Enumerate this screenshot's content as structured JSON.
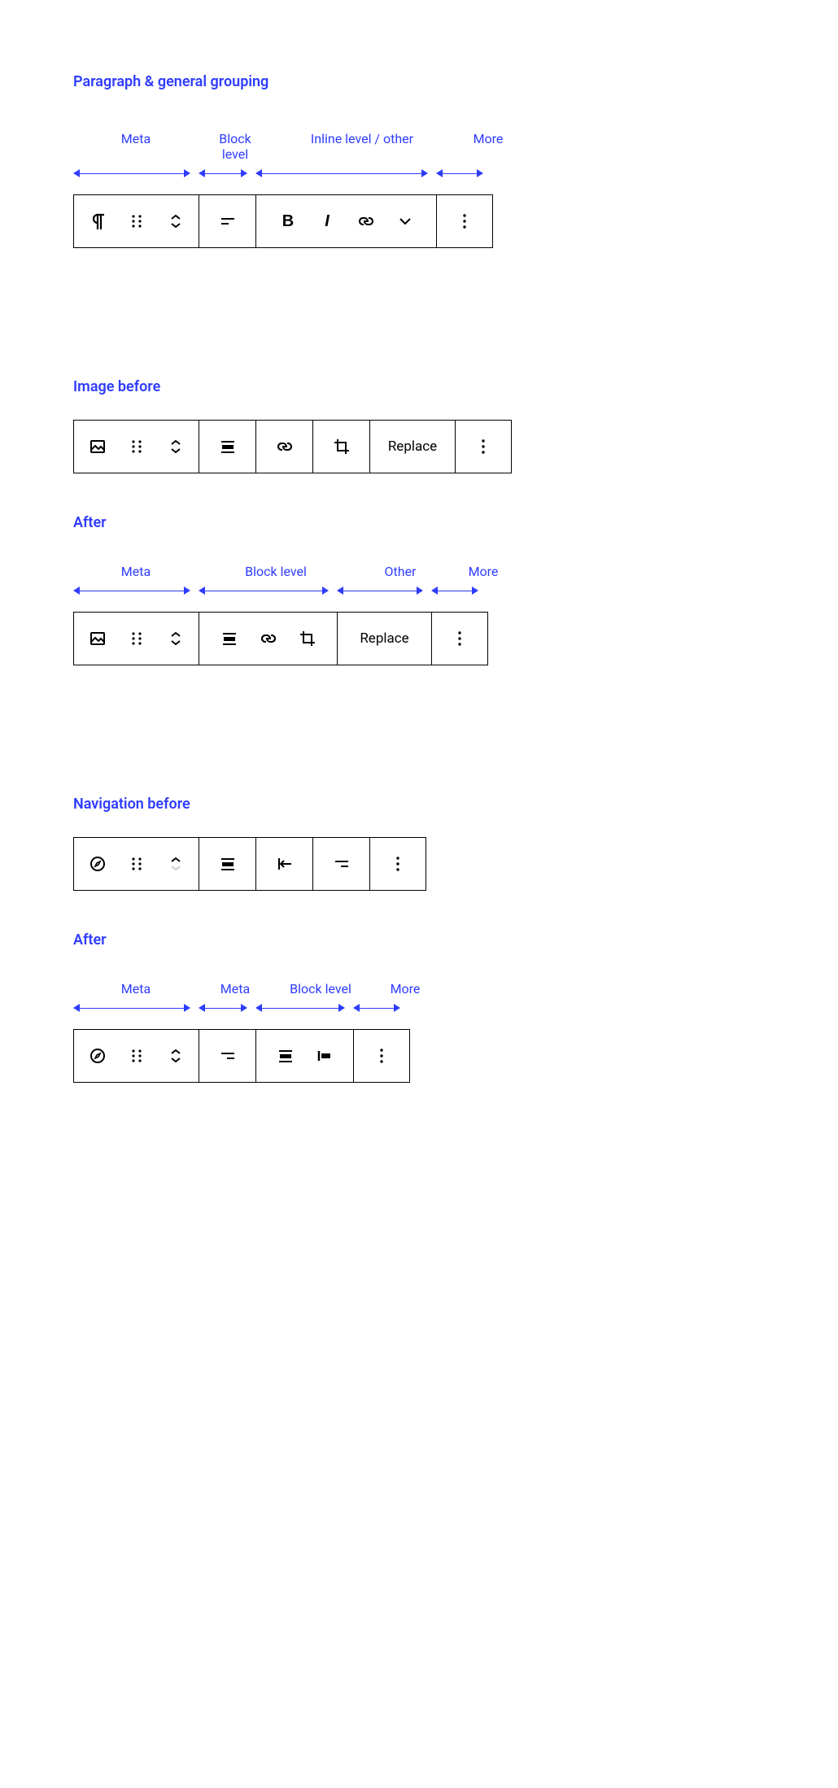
{
  "sections": {
    "paragraph": {
      "title": "Paragraph & general grouping",
      "groups": [
        "Meta",
        "Block level",
        "Inline level / other",
        "More"
      ]
    },
    "image_before": {
      "title": "Image before",
      "replace_label": "Replace"
    },
    "image_after": {
      "title": "After",
      "groups": [
        "Meta",
        "Block level",
        "Other",
        "More"
      ],
      "replace_label": "Replace"
    },
    "nav_before": {
      "title": "Navigation before"
    },
    "nav_after": {
      "title": "After",
      "groups": [
        "Meta",
        "Meta",
        "Block level",
        "More"
      ]
    }
  },
  "icons": {
    "paragraph": "paragraph-icon",
    "drag": "drag-icon",
    "move": "move-icon",
    "align_left": "align-left-icon",
    "bold": "bold-icon",
    "italic": "italic-icon",
    "link": "link-icon",
    "chevron_down": "chevron-down-icon",
    "more": "more-icon",
    "image": "image-icon",
    "align_center": "align-center-icon",
    "crop": "crop-icon",
    "compass": "compass-icon",
    "outdent": "outdent-icon",
    "justify_left": "justify-left-icon",
    "justify_right": "justify-right-icon"
  }
}
